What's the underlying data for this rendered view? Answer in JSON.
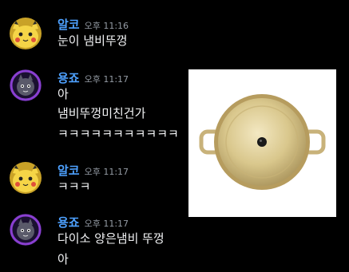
{
  "colors": {
    "background": "#000000",
    "username_user1": "#4ea1ff",
    "username_user2": "#4ea1ff",
    "timestamp": "#949ba4",
    "message_text": "#f2f3f5"
  },
  "messages": [
    {
      "author": "알코",
      "timestamp": "오후 11:16",
      "avatar_icon": "pikachu-avatar-icon",
      "lines": [
        "눈이 냄비뚜껑"
      ]
    },
    {
      "author": "용죠",
      "timestamp": "오후 11:17",
      "avatar_icon": "purple-cat-avatar-icon",
      "lines": [
        "아",
        "냄비뚜껑미친건가",
        "ㅋㅋㅋㅋㅋㅋㅋㅋㅋㅋㅋ"
      ],
      "attachment": {
        "icon": "gold-pot-lid-image"
      }
    },
    {
      "author": "알코",
      "timestamp": "오후 11:17",
      "avatar_icon": "pikachu-avatar-icon",
      "lines": [
        "ㅋㅋㅋ"
      ]
    },
    {
      "author": "용죠",
      "timestamp": "오후 11:17",
      "avatar_icon": "purple-cat-avatar-icon",
      "lines": [
        "다이소 양은냄비 뚜껑",
        "아"
      ]
    }
  ]
}
